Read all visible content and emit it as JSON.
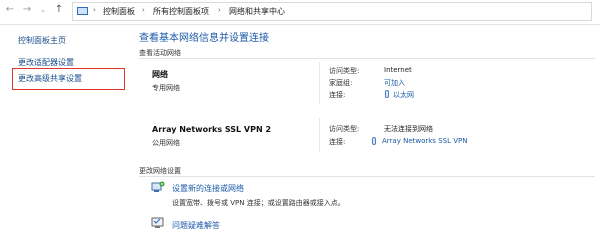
{
  "address_bar": {
    "crumbs": [
      "控制面板",
      "所有控制面板项",
      "网络和共享中心"
    ]
  },
  "left_nav": {
    "items": [
      "控制面板主页",
      "更改适配器设置",
      "更改高级共享设置"
    ]
  },
  "main": {
    "title": "查看基本网络信息并设置连接",
    "active_section": "查看活动网络",
    "networks": [
      {
        "name": "网络",
        "type": "专用网络",
        "access_type_label": "访问类型:",
        "access_type": "Internet",
        "homegroup_label": "家庭组:",
        "homegroup": "可加入",
        "connection_label": "连接:",
        "connection": "以太网"
      },
      {
        "name": "Array Networks SSL VPN  2",
        "type": "公用网络",
        "access_type_label": "访问类型:",
        "access_type": "无法连接到网络",
        "connection_label": "连接:",
        "connection": "Array Networks SSL VPN"
      }
    ],
    "change_section": "更改网络设置",
    "tasks": [
      {
        "link": "设置新的连接或网络",
        "desc": "设置宽带、拨号或 VPN 连接；或设置路由器或接入点。"
      },
      {
        "link": "问题疑难解答",
        "desc": ""
      }
    ]
  }
}
